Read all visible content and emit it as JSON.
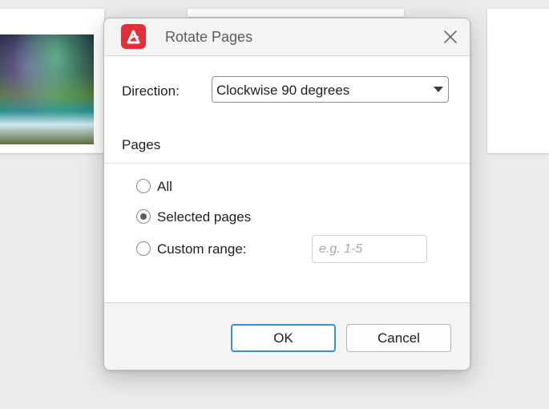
{
  "dialog": {
    "title": "Rotate Pages",
    "app_icon": "pdf-app-logo-icon",
    "close_icon": "close-icon",
    "accent_color": "#e0313a",
    "focus_color": "#3a8fd6"
  },
  "direction": {
    "label": "Direction:",
    "selected": "Clockwise 90 degrees"
  },
  "pages": {
    "section_label": "Pages",
    "options": [
      {
        "label": "All",
        "checked": false
      },
      {
        "label": "Selected pages",
        "checked": true
      },
      {
        "label": "Custom range:",
        "checked": false
      }
    ],
    "custom_range_placeholder": "e.g. 1-5",
    "custom_range_value": ""
  },
  "buttons": {
    "ok": "OK",
    "cancel": "Cancel"
  }
}
